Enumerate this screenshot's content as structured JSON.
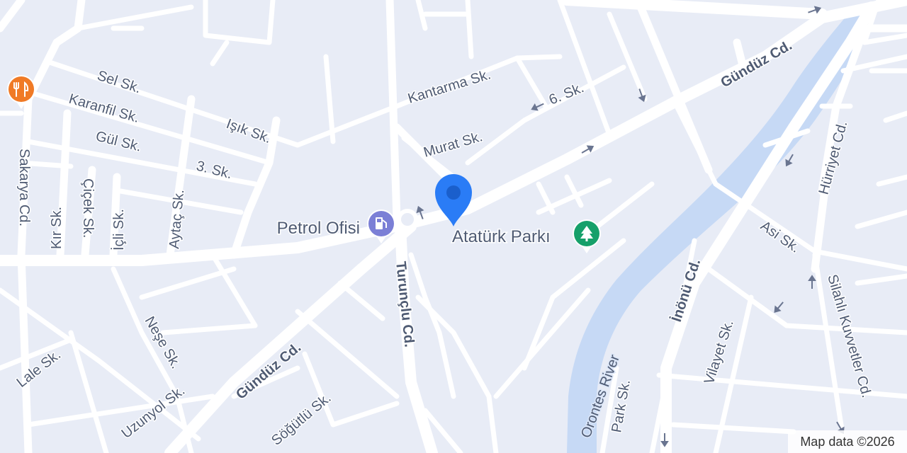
{
  "streets": {
    "gunduz_ne": "Gündüz Cd.",
    "gunduz_sw": "Gündüz Cd.",
    "kantarma": "Kantarma Sk.",
    "murat": "Murat Sk.",
    "alti": "6. Sk.",
    "sel": "Sel Sk.",
    "karanfil": "Karanfil Sk.",
    "isik": "Işık Sk.",
    "gul": "Gül Sk.",
    "uc": "3. Sk.",
    "sakarya": "Sakarya Cd.",
    "kir": "Kır Sk.",
    "cicek": "Çiçek Sk.",
    "icli": "İçli Sk.",
    "aytac": "Aytaç Sk.",
    "turunclu": "Turunçlu Cd.",
    "nese": "Neşe Sk.",
    "lale": "Lale Sk.",
    "uzunyol": "Uzunyol Sk.",
    "sogutlu": "Söğütlü Sk.",
    "hurriyet": "Hürriyet Cd.",
    "asi": "Asi Sk.",
    "inonu": "İnönü Cd.",
    "vilayet": "Vilayet Sk.",
    "silahli": "Silahlı Kuvvetler Cd.",
    "park": "Park Sk."
  },
  "river": "Orontes River",
  "pois": {
    "petrol": {
      "label": "Petrol Ofisi",
      "icon": "gas-station-icon",
      "color": "#7b7fd6"
    },
    "park": {
      "label": "Atatürk Parkı",
      "icon": "tree-icon",
      "color": "#16a06a"
    },
    "restaurant": {
      "icon": "restaurant-icon",
      "color": "#f07a26"
    }
  },
  "pin": {
    "icon": "location-pin-icon",
    "color": "#2a7cf6"
  },
  "attribution": "Map data ©2026"
}
